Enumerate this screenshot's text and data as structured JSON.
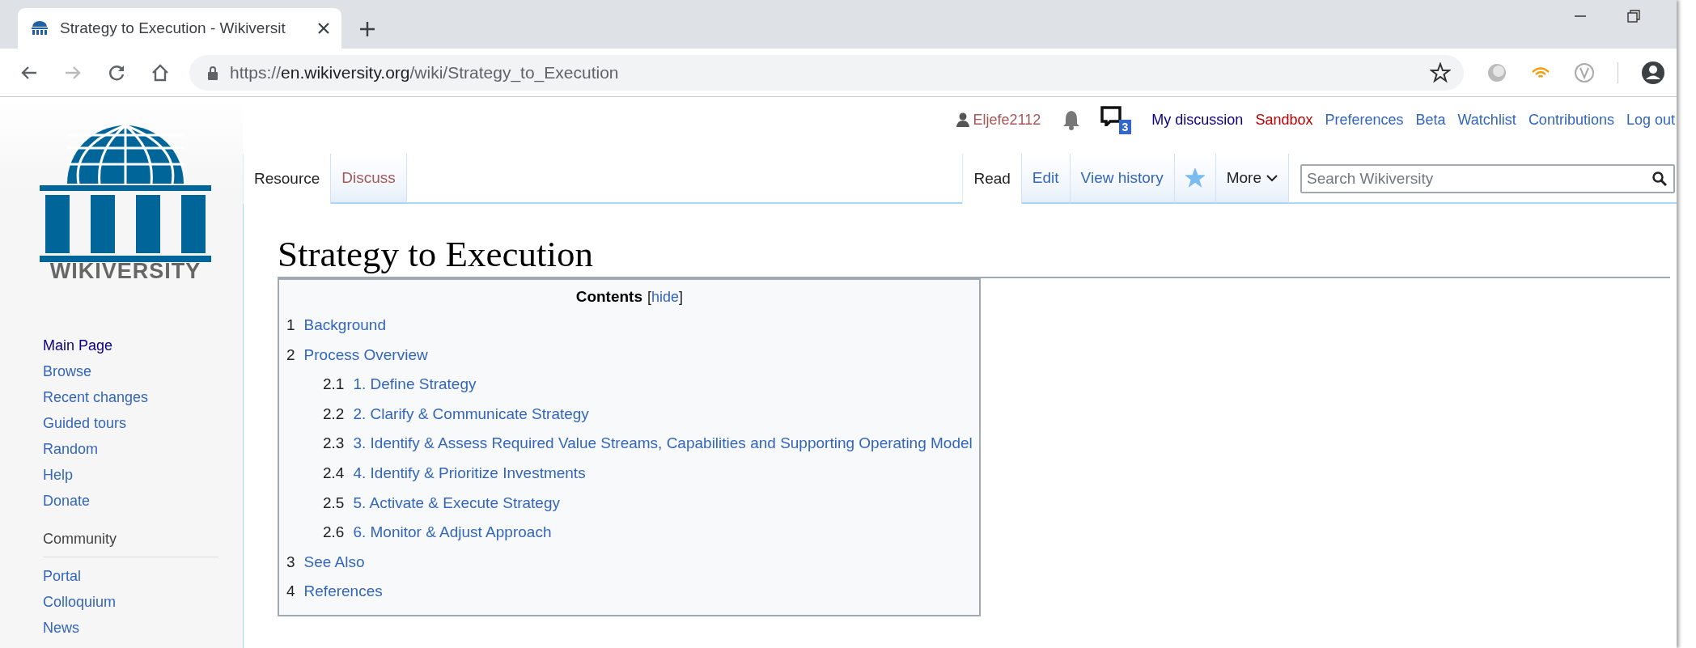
{
  "browser": {
    "tab": {
      "title": "Strategy to Execution - Wikiversit",
      "selected": true
    },
    "address": {
      "scheme": "https://",
      "host": "en.wikiversity.org",
      "path": "/wiki/Strategy_to_Execution"
    }
  },
  "personal_tools": {
    "user": {
      "label": "Eljefe2112",
      "kind": "new-visited"
    },
    "notices_count": "3",
    "links": [
      {
        "label": "My discussion",
        "kind": "visited"
      },
      {
        "label": "Sandbox",
        "kind": "new"
      },
      {
        "label": "Preferences",
        "kind": "link"
      },
      {
        "label": "Beta",
        "kind": "link"
      },
      {
        "label": "Watchlist",
        "kind": "link"
      },
      {
        "label": "Contributions",
        "kind": "link"
      },
      {
        "label": "Log out",
        "kind": "link"
      }
    ]
  },
  "logo": {
    "wordmark": "WIKIVERSITY"
  },
  "namespaces": [
    {
      "label": "Resource",
      "selected": true
    },
    {
      "label": "Discuss",
      "selected": false,
      "kind": "new-visited"
    }
  ],
  "views": [
    {
      "label": "Read",
      "selected": true
    },
    {
      "label": "Edit",
      "selected": false
    },
    {
      "label": "View history",
      "selected": false
    }
  ],
  "watch": {
    "watched": true
  },
  "more": {
    "label": "More"
  },
  "search": {
    "placeholder": "Search Wikiversity"
  },
  "sidebar": {
    "navigation": [
      {
        "label": "Main Page",
        "kind": "visited"
      },
      {
        "label": "Browse",
        "kind": "link"
      },
      {
        "label": "Recent changes",
        "kind": "link"
      },
      {
        "label": "Guided tours",
        "kind": "link"
      },
      {
        "label": "Random",
        "kind": "link"
      },
      {
        "label": "Help",
        "kind": "link"
      },
      {
        "label": "Donate",
        "kind": "link"
      }
    ],
    "sections": [
      {
        "heading": "Community",
        "items": [
          {
            "label": "Portal",
            "kind": "link"
          },
          {
            "label": "Colloquium",
            "kind": "link"
          },
          {
            "label": "News",
            "kind": "link"
          }
        ]
      }
    ]
  },
  "page": {
    "title": "Strategy to Execution",
    "toc": {
      "title": "Contents",
      "toggle": {
        "open": "[",
        "label": "hide",
        "close": "]"
      },
      "items": [
        {
          "number": "1",
          "label": "Background"
        },
        {
          "number": "2",
          "label": "Process Overview",
          "children": [
            {
              "number": "2.1",
              "label": "1. Define Strategy"
            },
            {
              "number": "2.2",
              "label": "2. Clarify & Communicate Strategy"
            },
            {
              "number": "2.3",
              "label": "3. Identify & Assess Required Value Streams, Capabilities and Supporting Operating Model"
            },
            {
              "number": "2.4",
              "label": "4. Identify & Prioritize Investments"
            },
            {
              "number": "2.5",
              "label": "5. Activate & Execute Strategy"
            },
            {
              "number": "2.6",
              "label": "6. Monitor & Adjust Approach"
            }
          ]
        },
        {
          "number": "3",
          "label": "See Also"
        },
        {
          "number": "4",
          "label": "References"
        }
      ]
    }
  }
}
